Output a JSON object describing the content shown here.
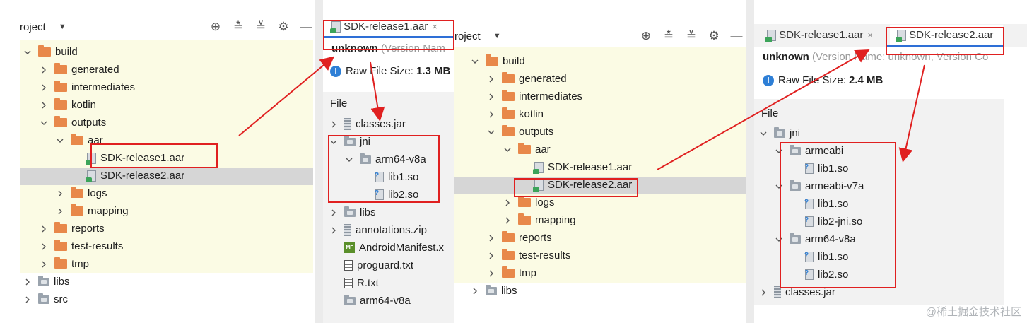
{
  "panel1": {
    "project_label": "roject",
    "tree": [
      {
        "label": "build",
        "indent": 0,
        "chev": "down",
        "icon": "folder-orange"
      },
      {
        "label": "generated",
        "indent": 1,
        "chev": "right",
        "icon": "folder-orange"
      },
      {
        "label": "intermediates",
        "indent": 1,
        "chev": "right",
        "icon": "folder-orange"
      },
      {
        "label": "kotlin",
        "indent": 1,
        "chev": "right",
        "icon": "folder-orange"
      },
      {
        "label": "outputs",
        "indent": 1,
        "chev": "down",
        "icon": "folder-orange"
      },
      {
        "label": "aar",
        "indent": 2,
        "chev": "down",
        "icon": "folder-orange"
      },
      {
        "label": "SDK-release1.aar",
        "indent": 3,
        "chev": "none",
        "icon": "aar-file"
      },
      {
        "label": "SDK-release2.aar",
        "indent": 3,
        "chev": "none",
        "icon": "aar-file"
      },
      {
        "label": "logs",
        "indent": 2,
        "chev": "right",
        "icon": "folder-orange"
      },
      {
        "label": "mapping",
        "indent": 2,
        "chev": "right",
        "icon": "folder-orange"
      },
      {
        "label": "reports",
        "indent": 1,
        "chev": "right",
        "icon": "folder-orange"
      },
      {
        "label": "test-results",
        "indent": 1,
        "chev": "right",
        "icon": "folder-orange"
      },
      {
        "label": "tmp",
        "indent": 1,
        "chev": "right",
        "icon": "folder-orange"
      },
      {
        "label": "libs",
        "indent": 0,
        "chev": "right",
        "icon": "folder-gray"
      },
      {
        "label": "src",
        "indent": 0,
        "chev": "right",
        "icon": "folder-gray"
      }
    ]
  },
  "panel2": {
    "tab_label": "SDK-release1.aar",
    "tab_close": "×",
    "name_bold": "unknown",
    "name_rest": "(Version Nam",
    "size_label": "Raw File Size:",
    "size_value": "1.3 MB",
    "file_header": "File",
    "tree": [
      {
        "label": "classes.jar",
        "indent": 0,
        "chev": "right",
        "icon": "jar-file"
      },
      {
        "label": "jni",
        "indent": 0,
        "chev": "down",
        "icon": "folder-gray"
      },
      {
        "label": "arm64-v8a",
        "indent": 1,
        "chev": "down",
        "icon": "folder-gray"
      },
      {
        "label": "lib1.so",
        "indent": 2,
        "chev": "none",
        "icon": "so-file"
      },
      {
        "label": "lib2.so",
        "indent": 2,
        "chev": "none",
        "icon": "so-file"
      },
      {
        "label": "libs",
        "indent": 0,
        "chev": "right",
        "icon": "folder-gray"
      },
      {
        "label": "annotations.zip",
        "indent": 0,
        "chev": "right",
        "icon": "jar-file"
      },
      {
        "label": "AndroidManifest.x",
        "indent": 0,
        "chev": "none",
        "icon": "manifest-file"
      },
      {
        "label": "proguard.txt",
        "indent": 0,
        "chev": "none",
        "icon": "txt-file"
      },
      {
        "label": "R.txt",
        "indent": 0,
        "chev": "none",
        "icon": "txt-file"
      },
      {
        "label": "arm64-v8a",
        "indent": 0,
        "chev": "none",
        "icon": "folder-gray"
      }
    ]
  },
  "panel3": {
    "project_label": "roject",
    "tree": [
      {
        "label": "build",
        "indent": 0,
        "chev": "down",
        "icon": "folder-orange"
      },
      {
        "label": "generated",
        "indent": 1,
        "chev": "right",
        "icon": "folder-orange"
      },
      {
        "label": "intermediates",
        "indent": 1,
        "chev": "right",
        "icon": "folder-orange"
      },
      {
        "label": "kotlin",
        "indent": 1,
        "chev": "right",
        "icon": "folder-orange"
      },
      {
        "label": "outputs",
        "indent": 1,
        "chev": "down",
        "icon": "folder-orange"
      },
      {
        "label": "aar",
        "indent": 2,
        "chev": "down",
        "icon": "folder-orange"
      },
      {
        "label": "SDK-release1.aar",
        "indent": 3,
        "chev": "none",
        "icon": "aar-file"
      },
      {
        "label": "SDK-release2.aar",
        "indent": 3,
        "chev": "none",
        "icon": "aar-file"
      },
      {
        "label": "logs",
        "indent": 2,
        "chev": "right",
        "icon": "folder-orange"
      },
      {
        "label": "mapping",
        "indent": 2,
        "chev": "right",
        "icon": "folder-orange"
      },
      {
        "label": "reports",
        "indent": 1,
        "chev": "right",
        "icon": "folder-orange"
      },
      {
        "label": "test-results",
        "indent": 1,
        "chev": "right",
        "icon": "folder-orange"
      },
      {
        "label": "tmp",
        "indent": 1,
        "chev": "right",
        "icon": "folder-orange"
      },
      {
        "label": "libs",
        "indent": 0,
        "chev": "right",
        "icon": "folder-gray"
      }
    ]
  },
  "panel4": {
    "tab1_label": "SDK-release1.aar",
    "tab1_close": "×",
    "tab2_label": "SDK-release2.aar",
    "name_bold": "unknown",
    "name_rest": "(Version Name: unknown, Version Co",
    "size_label": "Raw File Size:",
    "size_value": "2.4 MB",
    "file_header": "File",
    "tree": [
      {
        "label": "jni",
        "indent": 0,
        "chev": "down",
        "icon": "folder-gray"
      },
      {
        "label": "armeabi",
        "indent": 1,
        "chev": "down",
        "icon": "folder-gray"
      },
      {
        "label": "lib1.so",
        "indent": 2,
        "chev": "none",
        "icon": "so-file"
      },
      {
        "label": "armeabi-v7a",
        "indent": 1,
        "chev": "down",
        "icon": "folder-gray"
      },
      {
        "label": "lib1.so",
        "indent": 2,
        "chev": "none",
        "icon": "so-file"
      },
      {
        "label": "lib2-jni.so",
        "indent": 2,
        "chev": "none",
        "icon": "so-file"
      },
      {
        "label": "arm64-v8a",
        "indent": 1,
        "chev": "down",
        "icon": "folder-gray"
      },
      {
        "label": "lib1.so",
        "indent": 2,
        "chev": "none",
        "icon": "so-file"
      },
      {
        "label": "lib2.so",
        "indent": 2,
        "chev": "none",
        "icon": "so-file"
      },
      {
        "label": "classes.jar",
        "indent": 0,
        "chev": "right",
        "icon": "jar-file"
      }
    ]
  },
  "watermark": "@稀土掘金技术社区",
  "colors": {
    "highlight_box": "#e02020",
    "selection": "#d6d6d6",
    "tree_bg": "#fbfbe4",
    "accent_tab": "#2e6fd6"
  }
}
